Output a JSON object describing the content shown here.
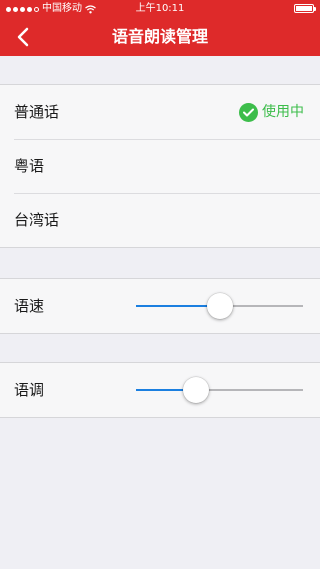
{
  "status_bar": {
    "carrier": "中国移动",
    "time": "上午10:11",
    "signal_icon": "signal-dots-icon",
    "wifi_icon": "wifi-icon",
    "battery_icon": "battery-icon"
  },
  "header": {
    "title": "语音朗读管理",
    "back_icon": "chevron-left-icon",
    "color": "#de2a2a"
  },
  "voices": [
    {
      "label": "普通话",
      "in_use": true,
      "status_text": "使用中"
    },
    {
      "label": "粤语",
      "in_use": false
    },
    {
      "label": "台湾话",
      "in_use": false
    }
  ],
  "speed": {
    "label": "语速",
    "value": 0.5
  },
  "pitch": {
    "label": "语调",
    "value": 0.36
  },
  "colors": {
    "accent_blue": "#1b7fe0",
    "in_use_green": "#3dbd4b"
  }
}
